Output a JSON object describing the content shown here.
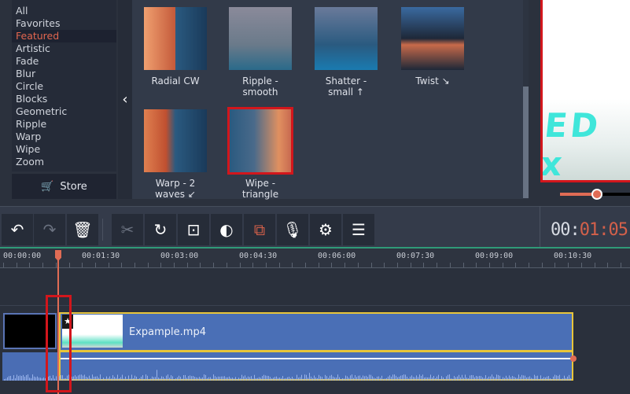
{
  "categories": [
    {
      "label": "All"
    },
    {
      "label": "Favorites"
    },
    {
      "label": "Featured",
      "selected": true
    },
    {
      "label": "Artistic"
    },
    {
      "label": "Fade"
    },
    {
      "label": "Blur"
    },
    {
      "label": "Circle"
    },
    {
      "label": "Blocks"
    },
    {
      "label": "Geometric"
    },
    {
      "label": "Ripple"
    },
    {
      "label": "Warp"
    },
    {
      "label": "Wipe"
    },
    {
      "label": "Zoom"
    }
  ],
  "store": {
    "label": "Store",
    "icon": "cart-icon"
  },
  "collapse_icon": "‹",
  "transitions": [
    {
      "line1": "Radial CW",
      "line2": ""
    },
    {
      "line1": "Ripple -",
      "line2": "smooth"
    },
    {
      "line1": "Shatter -",
      "line2": "small ↑"
    },
    {
      "line1": "Twist ↘",
      "line2": ""
    },
    {
      "line1": "Warp - 2",
      "line2": "waves ↙"
    },
    {
      "line1": "Wipe -",
      "line2": "triangle",
      "selected": true
    }
  ],
  "preview": {
    "overlay_text": "ED x",
    "volume_percent": 45
  },
  "toolbar": {
    "undo": "↶",
    "redo": "↷",
    "delete": "🗑",
    "cut": "✂",
    "rotate": "↻",
    "crop": "⊡",
    "color": "◐",
    "transition": "⧉",
    "record": "🎙",
    "settings": "⚙",
    "equalizer": "☰"
  },
  "timecode": {
    "prefix": "00:",
    "value": "01:05"
  },
  "ruler": [
    "00:00:00",
    "00:01:30",
    "00:03:00",
    "00:04:30",
    "00:06:00",
    "00:07:30",
    "00:09:00",
    "00:10:30"
  ],
  "clip": {
    "name": "Expample.mp4",
    "star": "★"
  },
  "colors": {
    "accent": "#e06c55",
    "selection": "#d2161c",
    "clip": "#4a6fb6",
    "clip_border": "#e8c53a",
    "timeline_line": "#2f9a78"
  }
}
